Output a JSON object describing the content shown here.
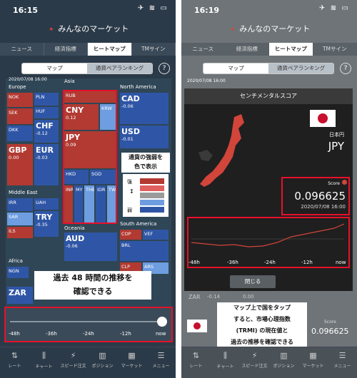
{
  "left": {
    "time": "16:15",
    "status_icons": "✈ ≋ ▭",
    "title": "みんなのマーケット",
    "tabs": [
      "ニュース",
      "経済指標",
      "ヒートマップ",
      "TMサイン"
    ],
    "subtabs": [
      "マップ",
      "通貨ペアランキング"
    ],
    "help": "?",
    "date": "2020/07/08 16:00",
    "regions": {
      "europe": "Europe",
      "asia": "Asia",
      "north_america": "North America",
      "middle_east": "Middle East",
      "oceania": "Oceania",
      "south_america": "South America",
      "africa": "Africa"
    },
    "cells": {
      "nok": "NOK",
      "pln": "PLN",
      "sek": "SEK",
      "huf": "HUF",
      "dkk": "DKK",
      "chf": "CHF",
      "chf_v": "-0.12",
      "gbp": "GBP",
      "gbp_v": "0.00",
      "eur": "EUR",
      "eur_v": "-0.03",
      "rub": "RUB",
      "cny": "CNY",
      "cny_v": "0.12",
      "krw": "KRW",
      "jpy": "JPY",
      "jpy_v": "0.09",
      "hkd": "HKD",
      "sgd": "SGD",
      "inr": "INR",
      "myr": "MYR",
      "thb": "THB",
      "idr": "IDR",
      "twd": "TWD",
      "cad": "CAD",
      "cad_v": "-0.06",
      "usd": "USD",
      "usd_v": "-0.01",
      "irr": "IRR",
      "uah": "UAH",
      "sar": "SAR",
      "try": "TRY",
      "try_v": "-0.35",
      "ils": "ILS",
      "aud": "AUD",
      "aud_v": "-0.06",
      "cop": "COP",
      "vef": "VEF",
      "brl": "BRL",
      "clp": "CLP",
      "ars": "ARS",
      "ngn": "NGN",
      "zar": "ZAR"
    },
    "legend": {
      "title_l1": "通貨の強弱を",
      "title_l2": "色で表示",
      "strong": "強",
      "weak": "弱"
    },
    "callout_l1": "過去 48 時間の推移を",
    "callout_l2": "確認できる",
    "slider_ticks": [
      "-48h",
      "-36h",
      "-24h",
      "-12h",
      "now"
    ],
    "nav": [
      "レート",
      "チャート",
      "スピード注文",
      "ポジション",
      "マーケット",
      "メニュー"
    ]
  },
  "right": {
    "time": "16:19",
    "title": "みんなのマーケット",
    "tabs": [
      "ニュース",
      "経済指標",
      "ヒートマップ",
      "TMサイン"
    ],
    "subtabs": [
      "マップ",
      "通貨ペアランキング"
    ],
    "date": "2020/07/08 16:00",
    "modal_title": "センチメンタルスコア",
    "flag_label": "日本円",
    "currency": "JPY",
    "score_label": "Score",
    "score": "0.096625",
    "score_date": "2020/07/08 16:00",
    "chart_ticks": [
      "-48h",
      "-36h",
      "-24h",
      "-12h",
      "now"
    ],
    "close": "閉じる",
    "callout_l1": "マップ上で国をタップ",
    "callout_l2": "すると、市場心理指数",
    "callout_l3": "(TRMI) の現在値と",
    "callout_l4": "過去の推移を確認できる",
    "bottom_score_label": "Score",
    "bottom_score": "0.096625",
    "bg_zar": "ZAR",
    "bg_zar_v": "-0.14",
    "bg_v2": "0.00",
    "nav": [
      "レート",
      "チャート",
      "スピード注文",
      "ポジション",
      "マーケット",
      "メニュー"
    ]
  },
  "colors": {
    "strong": "#b23a32",
    "weak": "#2f56a6",
    "highlight": "#e8102a"
  }
}
